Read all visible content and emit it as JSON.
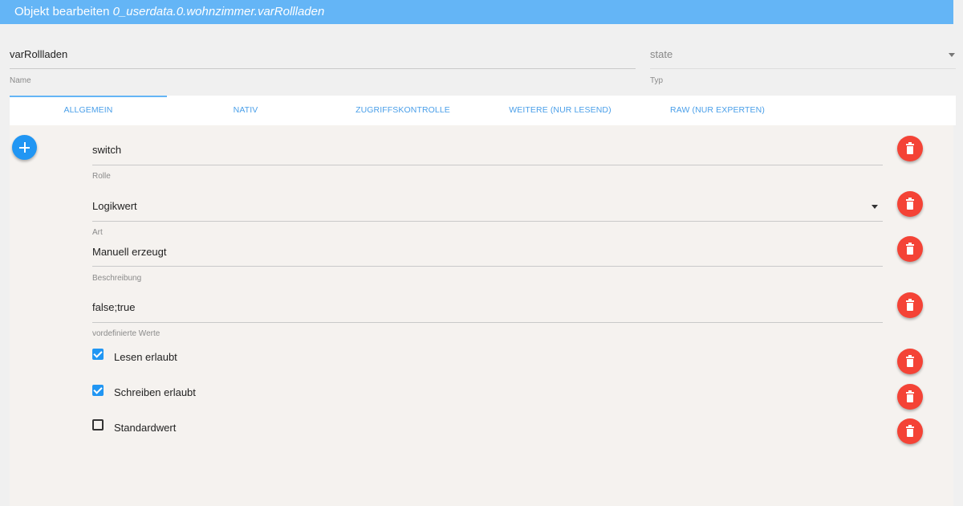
{
  "window": {
    "title_prefix": "Objekt bearbeiten",
    "object_id": "0_userdata.0.wohnzimmer.varRollladen"
  },
  "header": {
    "name_value": "varRollladen",
    "name_label": "Name",
    "type_value": "state",
    "type_label": "Typ"
  },
  "tabs": [
    {
      "label": "ALLGEMEIN",
      "active": true
    },
    {
      "label": "NATIV"
    },
    {
      "label": "ZUGRIFFSKONTROLLE"
    },
    {
      "label": "WEITERE (NUR LESEND)"
    },
    {
      "label": "RAW (NUR EXPERTEN)"
    }
  ],
  "fields": {
    "rolle": {
      "value": "switch",
      "label": "Rolle"
    },
    "art": {
      "value": "Logikwert",
      "label": "Art"
    },
    "beschreibung": {
      "value": "Manuell erzeugt",
      "label": "Beschreibung"
    },
    "werte": {
      "value": "false;true",
      "label": "vordefinierte Werte"
    }
  },
  "checkboxes": [
    {
      "label": "Lesen erlaubt",
      "checked": true
    },
    {
      "label": "Schreiben erlaubt",
      "checked": true
    },
    {
      "label": "Standardwert",
      "checked": false
    }
  ],
  "colors": {
    "titlebar": "#64b5f6",
    "accent": "#2196f3",
    "delete": "#f44336"
  },
  "icons": {
    "add": "plus-icon",
    "delete": "trash-icon",
    "dropdown": "caret-down-icon"
  }
}
